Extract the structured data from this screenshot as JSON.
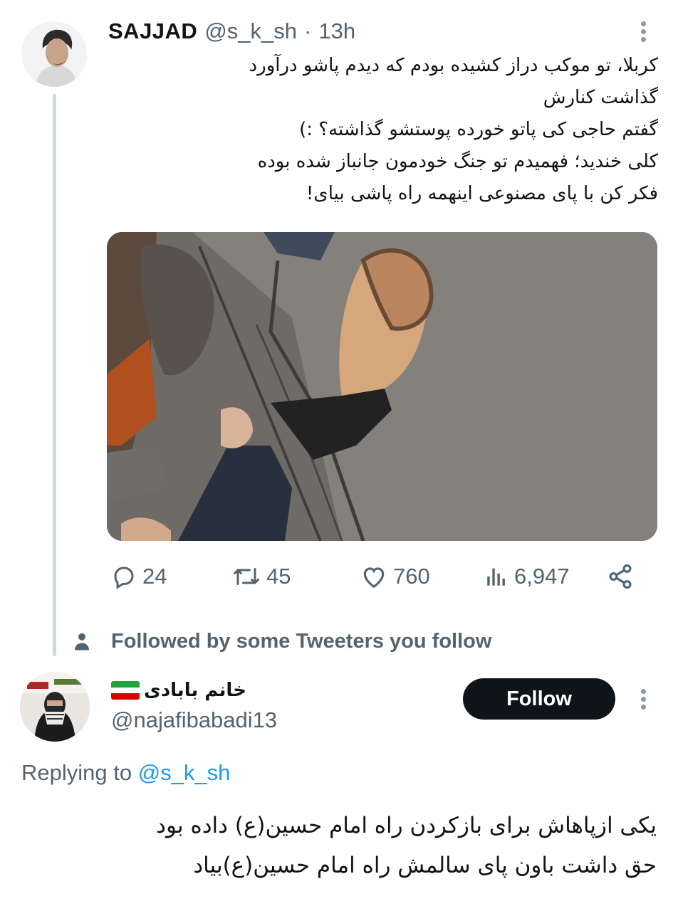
{
  "tweet": {
    "author_name": "SAJJAD",
    "author_handle": "@s_k_sh",
    "separator": "·",
    "time_ago": "13h",
    "text_lines": [
      "کربلا، تو موکب دراز کشیده بودم که دیدم پاشو درآورد",
      "گذاشت کنارش",
      "گفتم حاجی کی پاتو خورده پوستشو گذاشته؟ :)",
      "کلی خندید؛ فهمیدم تو جنگ خودمون جانباز شده بوده",
      "فکر کن با پای مصنوعی اینهمه راه پاشی بیای!"
    ],
    "actions": {
      "replies": "24",
      "retweets": "45",
      "likes": "760",
      "views": "6,947"
    }
  },
  "social_context": {
    "text": "Followed by some Tweeters you follow"
  },
  "reply": {
    "author_name": "خانم بابادی",
    "author_handle": "@najafibabadi13",
    "follow_label": "Follow",
    "replying_prefix": "Replying to",
    "replying_handle": "@s_k_sh",
    "text_lines": [
      "یکی ازپاهاش برای بازکردن راه امام حسین(ع) داده بود",
      "حق داشت باون پای سالمش راه امام حسین(ع)بیاد"
    ]
  },
  "icons": {
    "reply": "speech-bubble-icon",
    "retweet": "retweet-arrows-icon",
    "like": "heart-icon",
    "views": "bar-chart-icon",
    "share": "share-icon",
    "more": "vertical-dots-icon",
    "followed": "person-icon",
    "flag": "iran-flag-emoji"
  },
  "colors": {
    "text_primary": "#0f1419",
    "text_secondary": "#536471",
    "link": "#1d9bf0",
    "thread_line": "#cfd9de",
    "follow_button_bg": "#0f1419"
  }
}
